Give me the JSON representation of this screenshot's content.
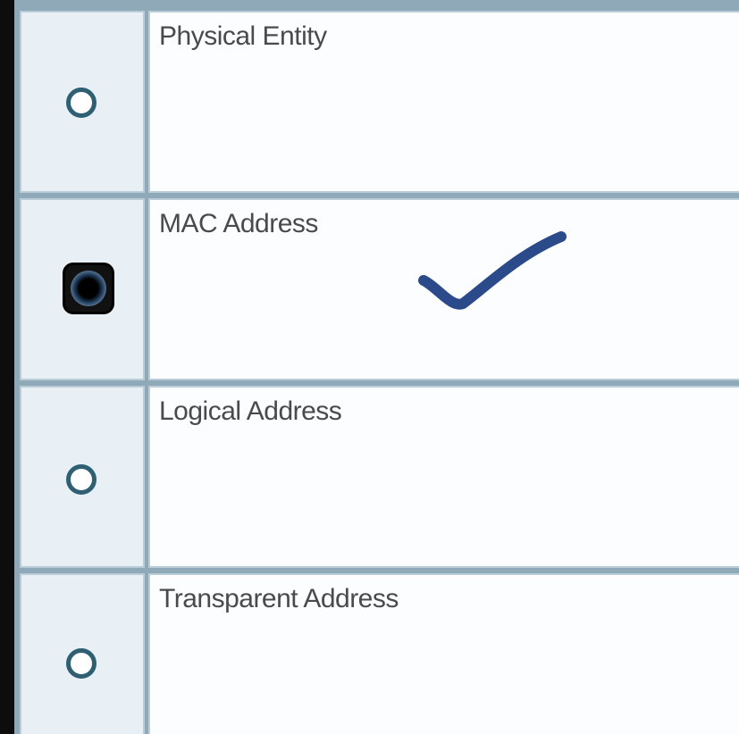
{
  "question": {
    "options": [
      {
        "label": "Physical Entity",
        "selected": false
      },
      {
        "label": "MAC Address",
        "selected": true
      },
      {
        "label": "Logical Address",
        "selected": false
      },
      {
        "label": "Transparent Address",
        "selected": false
      }
    ]
  },
  "annotation": {
    "type": "hand-drawn-checkmark",
    "color": "#2b4a8a"
  },
  "colors": {
    "row_border": "#8fa9b8",
    "radio_cell_bg": "#e8f0f6",
    "text_cell_bg": "#fcfdff",
    "radio_ring": "#2f5f73"
  }
}
